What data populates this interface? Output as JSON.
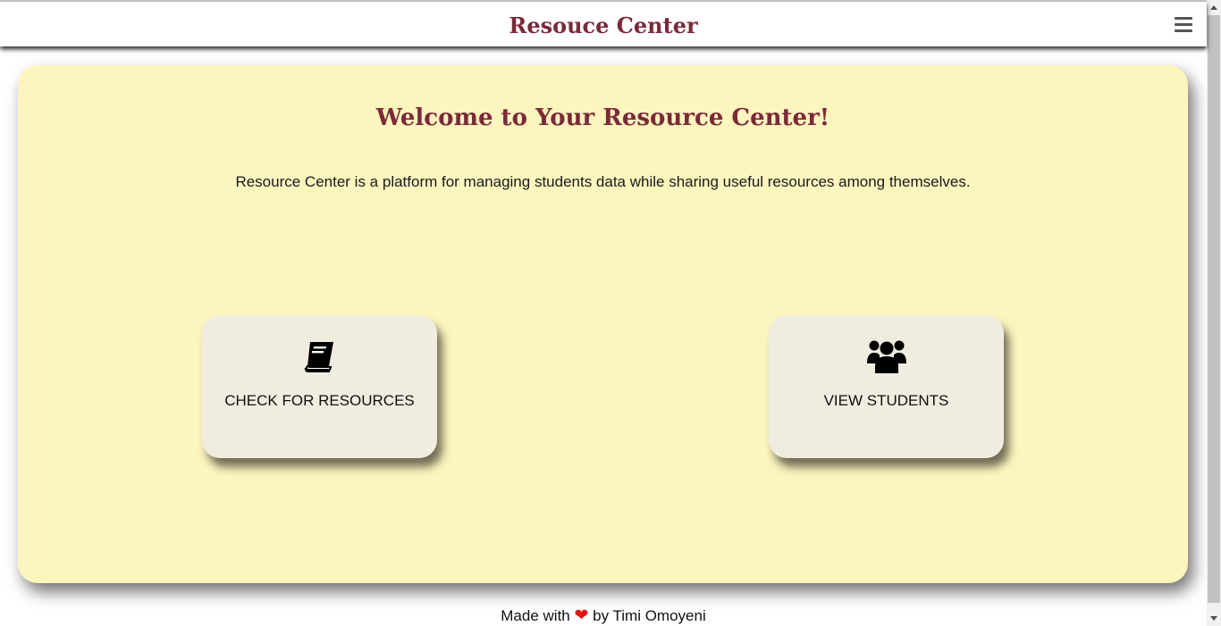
{
  "navbar": {
    "brand": "Resouce Center",
    "menu_icon": "hamburger-menu-icon"
  },
  "main": {
    "heading": "Welcome to Your Resource Center!",
    "description": "Resource Center is a platform for managing students data while sharing useful resources among themselves.",
    "tiles": [
      {
        "label": "CHECK FOR RESOURCES",
        "icon": "book-icon"
      },
      {
        "label": "VIEW STUDENTS",
        "icon": "users-icon"
      }
    ]
  },
  "footer": {
    "prefix": "Made with",
    "icon": "heart-icon",
    "suffix": "by Timi Omoyeni"
  },
  "colors": {
    "brand": "#7a2a3a",
    "card_background": "#fdf5be",
    "tile_background": "#f1ece0",
    "heart": "#e81010"
  }
}
